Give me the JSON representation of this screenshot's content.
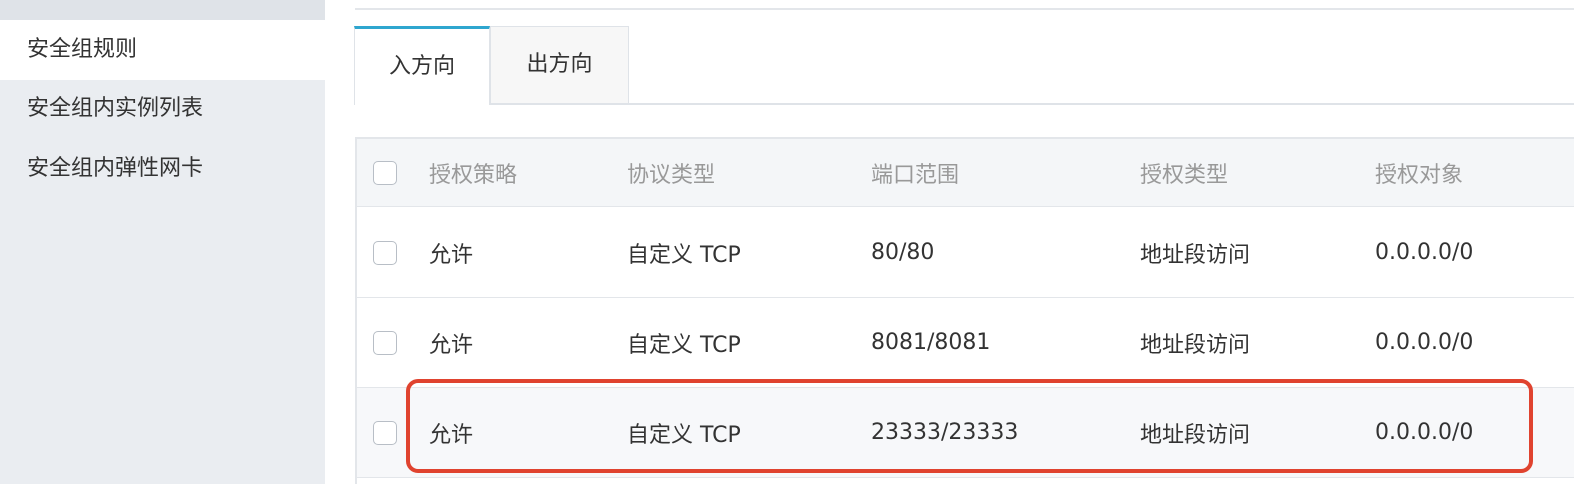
{
  "sidebar": {
    "items": [
      {
        "label": "安全组规则",
        "active": true
      },
      {
        "label": "安全组内实例列表",
        "active": false
      },
      {
        "label": "安全组内弹性网卡",
        "active": false
      }
    ]
  },
  "tabs": [
    {
      "label": "入方向",
      "active": true
    },
    {
      "label": "出方向",
      "active": false
    }
  ],
  "table": {
    "headers": [
      "授权策略",
      "协议类型",
      "端口范围",
      "授权类型",
      "授权对象"
    ],
    "rows": [
      [
        "允许",
        "自定义 TCP",
        "80/80",
        "地址段访问",
        "0.0.0.0/0"
      ],
      [
        "允许",
        "自定义 TCP",
        "8081/8081",
        "地址段访问",
        "0.0.0.0/0"
      ],
      [
        "允许",
        "自定义 TCP",
        "23333/23333",
        "地址段访问",
        "0.0.0.0/0"
      ]
    ]
  },
  "colors": {
    "sidebar_bg": "#eaedf1",
    "tab_accent": "#2ea6cf",
    "highlight_border": "#e0432f",
    "header_text": "#999999"
  }
}
